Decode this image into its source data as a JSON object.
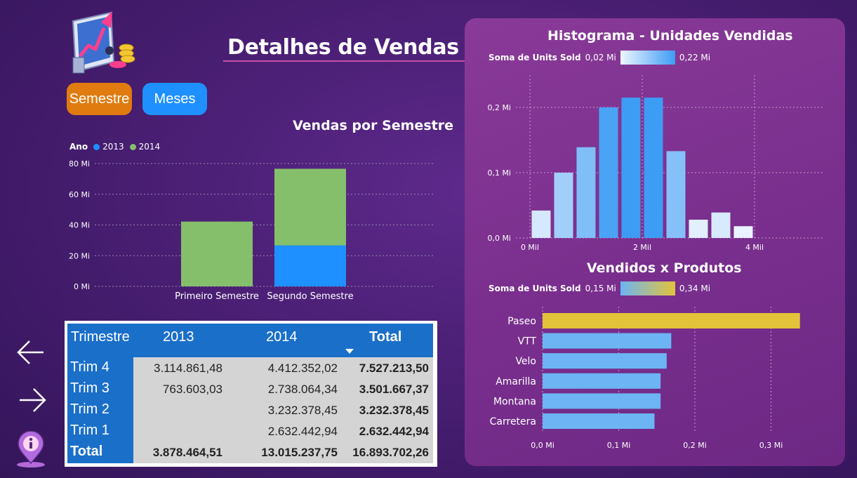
{
  "header": {
    "title": "Detalhes de Vendas"
  },
  "buttons": {
    "semestre": "Semestre",
    "meses": "Meses"
  },
  "colors": {
    "series_2013": "#1e90ff",
    "series_2014": "#86bf6b",
    "button_semestre": "#e07b10",
    "button_meses": "#1e90ff",
    "highlight_bar": "#e3c33a",
    "bar_blue": "#6cb4f4"
  },
  "icons": {
    "logo": "sales-chart-coins-icon",
    "back": "arrow-left-icon",
    "forward": "arrow-right-icon",
    "info": "info-pin-icon"
  },
  "chart_data": [
    {
      "type": "bar",
      "title": "Vendas por Semestre",
      "legend_title": "Ano",
      "legend_position": "top-left",
      "categories": [
        "Primeiro Semestre",
        "Segundo Semestre"
      ],
      "series": [
        {
          "name": "2013",
          "values": [
            0,
            26.7
          ]
        },
        {
          "name": "2014",
          "values": [
            42.2,
            49.9
          ]
        }
      ],
      "stacked": true,
      "yticks": [
        "0 Mi",
        "20 Mi",
        "40 Mi",
        "60 Mi",
        "80 Mi"
      ],
      "ylim": [
        0,
        80
      ],
      "grid": true
    },
    {
      "type": "bar",
      "title": "Histograma - Unidades Vendidas",
      "legend_label": "Soma de Units Sold",
      "color_scale": [
        "0,02 Mi",
        "0,22 Mi"
      ],
      "x": [
        0.2,
        0.6,
        1.0,
        1.4,
        1.8,
        2.2,
        2.6,
        3.0,
        3.4,
        3.8
      ],
      "values": [
        0.042,
        0.1,
        0.139,
        0.2,
        0.215,
        0.215,
        0.133,
        0.028,
        0.039,
        0.018
      ],
      "xticks": [
        "0 Mil",
        "2 Mil",
        "4 Mil"
      ],
      "yticks": [
        "0,0 Mi",
        "0,1 Mi",
        "0,2 Mi"
      ],
      "xlim": [
        0,
        4
      ],
      "ylim": [
        0,
        0.2
      ],
      "grid": true
    },
    {
      "type": "bar",
      "orientation": "horizontal",
      "title": "Vendidos x Produtos",
      "legend_label": "Soma de Units Sold",
      "color_scale": [
        "0,15 Mi",
        "0,34 Mi"
      ],
      "categories": [
        "Paseo",
        "VTT",
        "Velo",
        "Amarilla",
        "Montana",
        "Carretera"
      ],
      "values": [
        0.338,
        0.169,
        0.163,
        0.155,
        0.155,
        0.147
      ],
      "xticks": [
        "0,0 Mi",
        "0,1 Mi",
        "0,2 Mi",
        "0,3 Mi"
      ],
      "xlim": [
        0,
        0.3
      ],
      "grid": true
    },
    {
      "type": "table",
      "columns": [
        "Trimestre",
        "2013",
        "2014",
        "Total"
      ],
      "rows": [
        [
          "Trim 4",
          "3.114.861,48",
          "4.412.352,02",
          "7.527.213,50"
        ],
        [
          "Trim 3",
          "763.603,03",
          "2.738.064,34",
          "3.501.667,37"
        ],
        [
          "Trim 2",
          "",
          "3.232.378,45",
          "3.232.378,45"
        ],
        [
          "Trim 1",
          "",
          "2.632.442,94",
          "2.632.442,94"
        ],
        [
          "Total",
          "3.878.464,51",
          "13.015.237,75",
          "16.893.702,26"
        ]
      ]
    }
  ]
}
